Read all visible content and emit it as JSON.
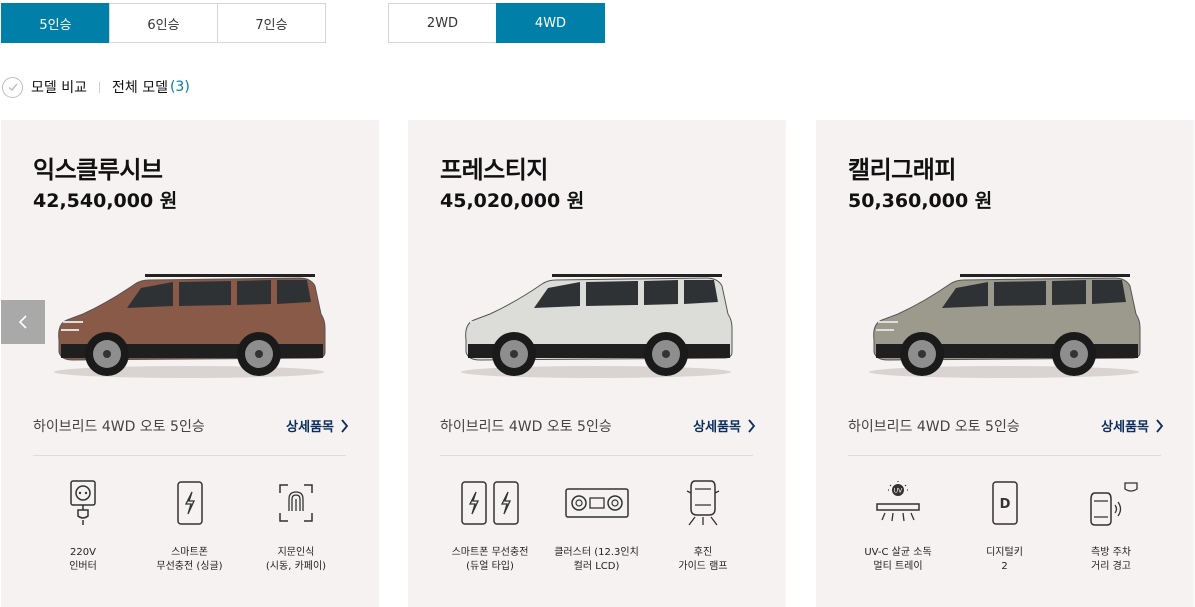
{
  "filters": {
    "seats": [
      {
        "label": "5인승",
        "active": true
      },
      {
        "label": "6인승",
        "active": false
      },
      {
        "label": "7인승",
        "active": false
      }
    ],
    "drive": [
      {
        "label": "2WD",
        "active": false
      },
      {
        "label": "4WD",
        "active": true
      }
    ]
  },
  "compare": {
    "label": "모델 비교",
    "all_models_label": "전체 모델",
    "count": "(3)"
  },
  "carousel": {
    "prev_icon": "chevron-left-icon"
  },
  "cards": [
    {
      "name": "익스클루시브",
      "price": "42,540,000 원",
      "color": "#8a5a48",
      "spec": "하이브리드 4WD 오토 5인승",
      "detail_label": "상세품목",
      "features": [
        {
          "icon": "power-outlet-icon",
          "label": "220V\n인버터"
        },
        {
          "icon": "wireless-charging-icon",
          "label": "스마트폰\n무선충전 (싱글)"
        },
        {
          "icon": "fingerprint-icon",
          "label": "지문인식\n(시동, 카페이)"
        }
      ]
    },
    {
      "name": "프레스티지",
      "price": "45,020,000 원",
      "color": "#dcdcd8",
      "spec": "하이브리드 4WD 오토 5인승",
      "detail_label": "상세품목",
      "features": [
        {
          "icon": "dual-wireless-charging-icon",
          "label": "스마트폰 무선충전\n(듀얼 타입)"
        },
        {
          "icon": "cluster-display-icon",
          "label": "클러스터 (12.3인치\n컬러 LCD)"
        },
        {
          "icon": "rear-guide-lamp-icon",
          "label": "후진\n가이드 램프"
        }
      ]
    },
    {
      "name": "캘리그래피",
      "price": "50,360,000 원",
      "color": "#9b9a8c",
      "spec": "하이브리드 4WD 오토 5인승",
      "detail_label": "상세품목",
      "features": [
        {
          "icon": "uv-sterilization-icon",
          "label": "UV-C 살균 소독\n멀티 트레이"
        },
        {
          "icon": "digital-key-icon",
          "label": "디지털키\n2"
        },
        {
          "icon": "side-parking-sensor-icon",
          "label": "측방 주차\n거리 경고"
        }
      ]
    }
  ]
}
